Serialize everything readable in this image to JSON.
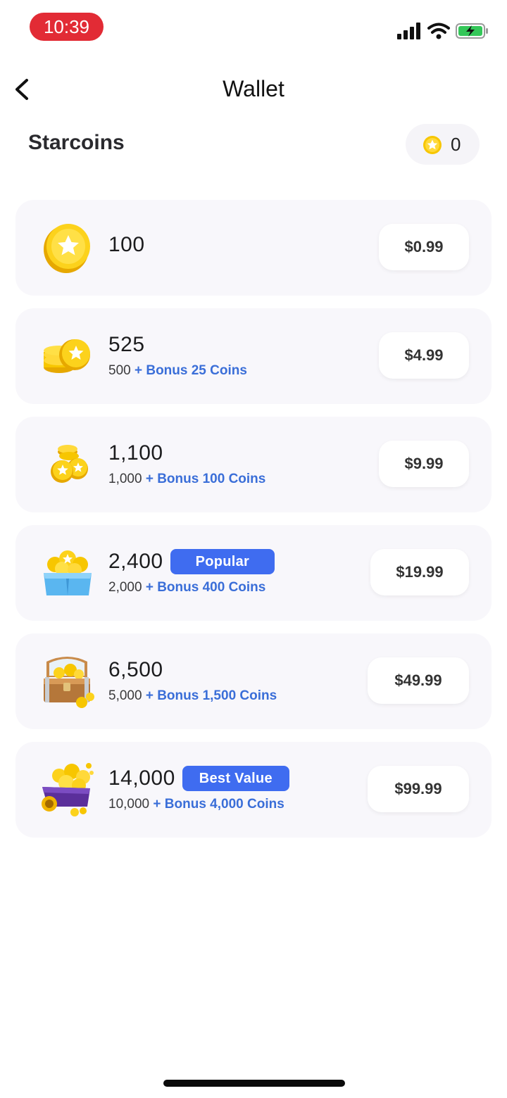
{
  "status_bar": {
    "time": "10:39",
    "icons": [
      "cellular-signal-icon",
      "wifi-icon",
      "battery-charging-icon"
    ]
  },
  "nav": {
    "back_icon": "chevron-left-icon",
    "title": "Wallet"
  },
  "header": {
    "title": "Starcoins",
    "balance_icon": "star-coin-icon",
    "balance": "0"
  },
  "packages": [
    {
      "amount": "100",
      "badge": "",
      "base": "",
      "bonus": "",
      "price": "$0.99",
      "icon": "single-star-coin-icon"
    },
    {
      "amount": "525",
      "badge": "",
      "base": "500",
      "bonus": "+ Bonus 25 Coins",
      "price": "$4.99",
      "icon": "coin-stack-icon"
    },
    {
      "amount": "1,100",
      "badge": "",
      "base": "1,000",
      "bonus": "+ Bonus 100 Coins",
      "price": "$9.99",
      "icon": "coin-pile-icon"
    },
    {
      "amount": "2,400",
      "badge": "Popular",
      "base": "2,000",
      "bonus": "+ Bonus 400 Coins",
      "price": "$19.99",
      "icon": "coin-box-icon"
    },
    {
      "amount": "6,500",
      "badge": "",
      "base": "5,000",
      "bonus": "+ Bonus 1,500 Coins",
      "price": "$49.99",
      "icon": "treasure-chest-icon"
    },
    {
      "amount": "14,000",
      "badge": "Best Value",
      "base": "10,000",
      "bonus": "+ Bonus 4,000 Coins",
      "price": "$99.99",
      "icon": "coin-cart-icon"
    }
  ],
  "colors": {
    "accent": "#3f6cf0",
    "bonus_text": "#3a6ed8",
    "status_pill": "#e22b35",
    "card_bg": "#f8f7fb",
    "coin_gold": "#f7c600"
  }
}
